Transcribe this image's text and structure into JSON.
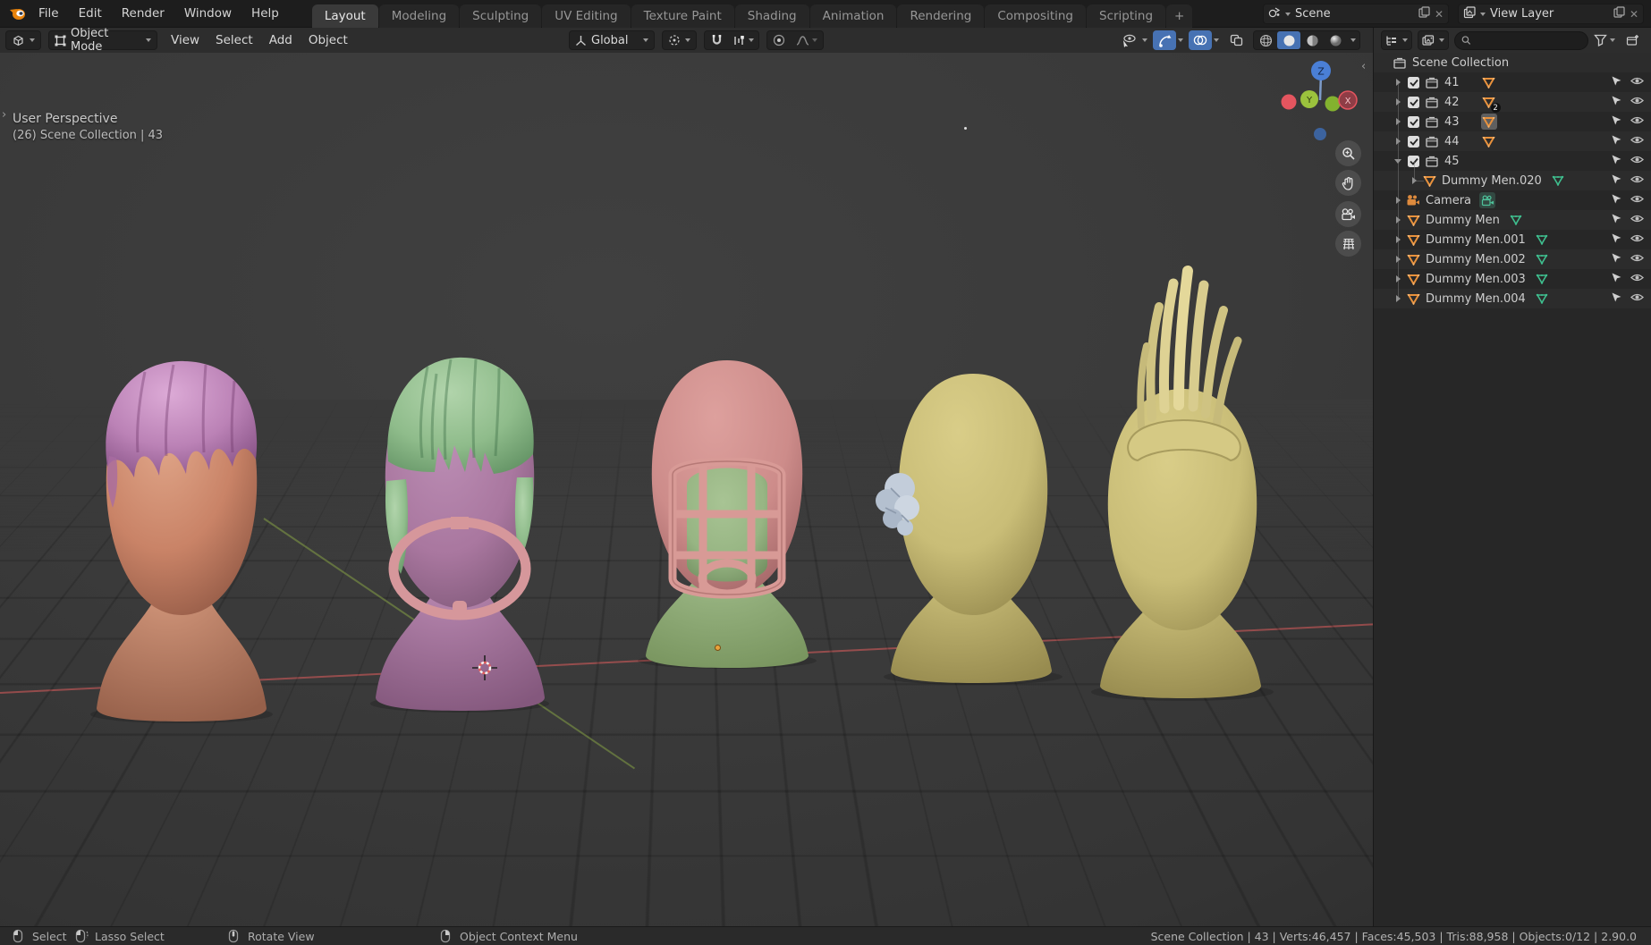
{
  "topbar": {
    "menus": [
      "File",
      "Edit",
      "Render",
      "Window",
      "Help"
    ],
    "tabs": [
      {
        "label": "Layout",
        "active": true
      },
      {
        "label": "Modeling",
        "active": false
      },
      {
        "label": "Sculpting",
        "active": false
      },
      {
        "label": "UV Editing",
        "active": false
      },
      {
        "label": "Texture Paint",
        "active": false
      },
      {
        "label": "Shading",
        "active": false
      },
      {
        "label": "Animation",
        "active": false
      },
      {
        "label": "Rendering",
        "active": false
      },
      {
        "label": "Compositing",
        "active": false
      },
      {
        "label": "Scripting",
        "active": false
      }
    ],
    "new_tab_label": "+",
    "scene_selector": {
      "value": "Scene"
    },
    "view_layer_selector": {
      "value": "View Layer"
    }
  },
  "tool_header": {
    "mode": "Object Mode",
    "menus": [
      "View",
      "Select",
      "Add",
      "Object"
    ],
    "orientation": "Global"
  },
  "viewport": {
    "overlay_line1": "User Perspective",
    "overlay_line2": "(26) Scene Collection | 43",
    "gizmo_axes": {
      "x": "X",
      "y": "Y",
      "z": "Z"
    },
    "objects": [
      {
        "name": "head-1",
        "skin": "#c98367",
        "hair": "#bb82b6"
      },
      {
        "name": "head-2",
        "skin": "#a9779f",
        "hair": "#8fbc8b",
        "goggles": "#d6979b"
      },
      {
        "name": "head-3",
        "skin": "#cd8c8a",
        "face": "#97b583",
        "helmet": "#cd8c8a"
      },
      {
        "name": "head-4",
        "skin": "#c9bd77",
        "flower": "#c3cdda"
      },
      {
        "name": "head-5",
        "skin": "#c9bd77",
        "mohawk": "#dcd092"
      }
    ]
  },
  "outliner": {
    "search_placeholder": "",
    "rows": [
      {
        "label": "Scene Collection",
        "kind": "root",
        "indent": 0
      },
      {
        "label": "41",
        "kind": "collection",
        "indent": 1,
        "arrow": "right",
        "checkbox": true,
        "tail": "mesh-orange"
      },
      {
        "label": "42",
        "kind": "collection",
        "indent": 1,
        "arrow": "right",
        "checkbox": true,
        "tail": "mesh-orange",
        "badge": "2"
      },
      {
        "label": "43",
        "kind": "collection",
        "indent": 1,
        "arrow": "right",
        "checkbox": true,
        "tail": "mesh-orange",
        "active": true
      },
      {
        "label": "44",
        "kind": "collection",
        "indent": 1,
        "arrow": "right",
        "checkbox": true,
        "tail": "mesh-orange"
      },
      {
        "label": "45",
        "kind": "collection",
        "indent": 1,
        "arrow": "down",
        "checkbox": true,
        "tail": null
      },
      {
        "label": "Dummy Men.020",
        "kind": "object",
        "indent": 2,
        "arrow": "right",
        "data_icon": "mesh-green"
      },
      {
        "label": "Camera",
        "kind": "camera",
        "indent": 1,
        "arrow": "right",
        "data_icon": "camera-green",
        "data_selected": true
      },
      {
        "label": "Dummy Men",
        "kind": "object",
        "indent": 1,
        "arrow": "right",
        "data_icon": "mesh-green"
      },
      {
        "label": "Dummy Men.001",
        "kind": "object",
        "indent": 1,
        "arrow": "right",
        "data_icon": "mesh-green"
      },
      {
        "label": "Dummy Men.002",
        "kind": "object",
        "indent": 1,
        "arrow": "right",
        "data_icon": "mesh-green"
      },
      {
        "label": "Dummy Men.003",
        "kind": "object",
        "indent": 1,
        "arrow": "right",
        "data_icon": "mesh-green"
      },
      {
        "label": "Dummy Men.004",
        "kind": "object",
        "indent": 1,
        "arrow": "right",
        "data_icon": "mesh-green"
      }
    ]
  },
  "statusbar": {
    "hints": [
      {
        "button": "left",
        "label": "Select"
      },
      {
        "button": "left-drag",
        "label": "Lasso Select"
      },
      {
        "button": "middle",
        "label": "Rotate View"
      },
      {
        "button": "right",
        "label": "Object Context Menu"
      }
    ],
    "info": "Scene Collection | 43 | Verts:46,457 | Faces:45,503 | Tris:88,958 | Objects:0/12 | 2.90.0"
  },
  "colors": {
    "accent_blue": "#4772b3",
    "object_orange": "#e8913c",
    "data_green": "#3fbe8e",
    "axis_x": "#e05d5d",
    "axis_y": "#8caa46",
    "axis_z": "#4a7fd6",
    "active_icon_bg": "#5f5f5f"
  }
}
